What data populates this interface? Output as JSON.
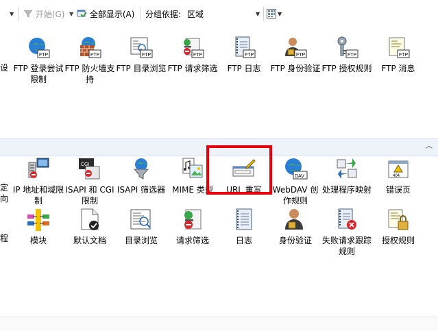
{
  "toolbar": {
    "start_label": "开始(G)",
    "show_all_label": "全部显示(A)",
    "group_by_label": "分组依据:",
    "group_by_value": "区域"
  },
  "ftp_items": [
    {
      "label": "FTP 登录尝试限制",
      "icon": "ftp-logon-icon"
    },
    {
      "label": "FTP 防火墙支持",
      "icon": "ftp-firewall-icon"
    },
    {
      "label": "FTP 目录浏览",
      "icon": "ftp-directory-icon"
    },
    {
      "label": "FTP 请求筛选",
      "icon": "ftp-request-filter-icon"
    },
    {
      "label": "FTP 日志",
      "icon": "ftp-log-icon"
    },
    {
      "label": "FTP 身份验证",
      "icon": "ftp-auth-icon"
    },
    {
      "label": "FTP 授权规则",
      "icon": "ftp-authz-icon"
    },
    {
      "label": "FTP 消息",
      "icon": "ftp-message-icon"
    }
  ],
  "ftp_partial_left": "设",
  "iis_row1_partial_left": "定向",
  "iis_row2_partial_left": "程",
  "iis_row1": [
    {
      "label": "IP 地址和域限制",
      "icon": "ip-restrictions-icon"
    },
    {
      "label": "ISAPI 和 CGI 限制",
      "icon": "isapi-cgi-icon"
    },
    {
      "label": "ISAPI 筛选器",
      "icon": "isapi-filter-icon"
    },
    {
      "label": "MIME 类型",
      "icon": "mime-types-icon"
    },
    {
      "label": "URL 重写",
      "icon": "url-rewrite-icon"
    },
    {
      "label": "WebDAV 创作规则",
      "icon": "webdav-icon"
    },
    {
      "label": "处理程序映射",
      "icon": "handler-mappings-icon"
    },
    {
      "label": "错误页",
      "icon": "error-pages-icon"
    }
  ],
  "iis_row2": [
    {
      "label": "模块",
      "icon": "modules-icon"
    },
    {
      "label": "默认文档",
      "icon": "default-document-icon"
    },
    {
      "label": "目录浏览",
      "icon": "directory-browsing-icon"
    },
    {
      "label": "请求筛选",
      "icon": "request-filtering-icon"
    },
    {
      "label": "日志",
      "icon": "logging-icon"
    },
    {
      "label": "身份验证",
      "icon": "authentication-icon"
    },
    {
      "label": "失败请求跟踪规则",
      "icon": "failed-request-tracing-icon"
    },
    {
      "label": "授权规则",
      "icon": "authorization-rules-icon"
    }
  ]
}
